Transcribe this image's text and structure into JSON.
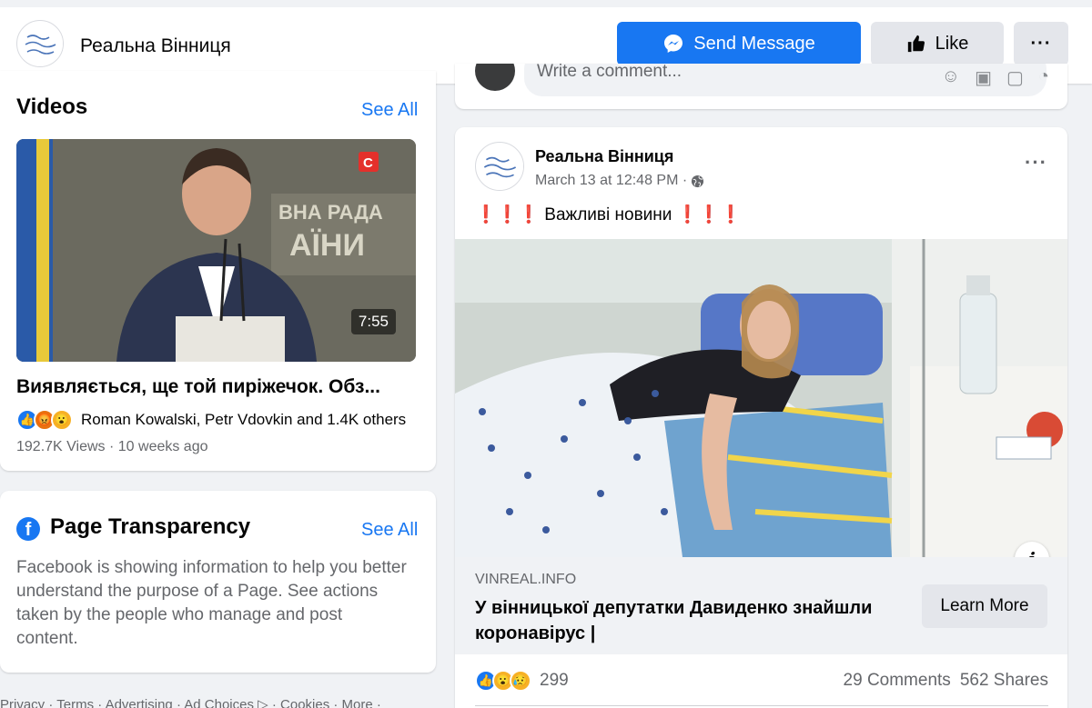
{
  "header": {
    "page_name": "Реальна Вінниця",
    "send_message_label": "Send Message",
    "like_label": "Like",
    "more_label": "···"
  },
  "videos": {
    "title": "Videos",
    "see_all": "See All",
    "item": {
      "duration": "7:55",
      "title": "Виявляється, ще той пиріжечок. Обз...",
      "reactions_text": "Roman Kowalski, Petr Vdovkin and 1.4K others",
      "reaction_icons": [
        "like-icon",
        "angry-icon",
        "wow-icon"
      ],
      "views_line": "192.7K Views · 10 weeks ago"
    }
  },
  "transparency": {
    "title": "Page Transparency",
    "see_all": "See All",
    "description": "Facebook is showing information to help you better understand the purpose of a Page. See actions taken by the people who manage and post content."
  },
  "footer": {
    "links_text": "Privacy · Terms · Advertising · Ad Choices ▷ · Cookies · More ·"
  },
  "comment_box": {
    "placeholder": "Write a comment..."
  },
  "post": {
    "author": "Реальна Вінниця",
    "timestamp": "March 13 at 12:48 PM ·",
    "privacy_icon": "globe-icon",
    "text_prefix": "❗❗❗",
    "text": "Важливі новини",
    "text_suffix": "❗❗❗",
    "link": {
      "domain": "VINREAL.INFO",
      "title": "У вінницької депутатки Давиденко знайшли коронавірус |",
      "button": "Learn More"
    },
    "stats": {
      "reaction_icons": [
        "like-icon",
        "wow-icon",
        "sad-icon"
      ],
      "reactions_count": "299",
      "comments": "29 Comments",
      "shares": "562 Shares"
    }
  },
  "colors": {
    "accent": "#1877f2",
    "background": "#f0f2f5",
    "secondary_button": "#e4e6eb",
    "muted_text": "#65676b"
  }
}
